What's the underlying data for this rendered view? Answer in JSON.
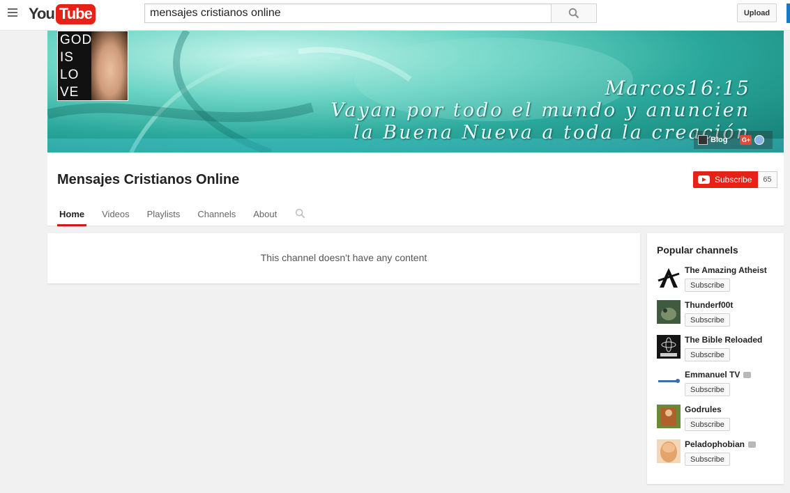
{
  "masthead": {
    "logo_you": "You",
    "logo_tube": "Tube",
    "search_value": "mensajes cristianos online",
    "upload_label": "Upload"
  },
  "banner": {
    "reference": "Marcos16:15",
    "line1": "Vayan por todo el mundo y anuncien",
    "line2": "la Buena Nueva  a  toda la  creación",
    "blog_label": "Blog",
    "gplus_label": "G+"
  },
  "avatar": {
    "text_lines": [
      "GOD",
      "IS",
      "LO",
      "VE"
    ]
  },
  "channel": {
    "title": "Mensajes Cristianos Online",
    "subscribe_label": "Subscribe",
    "subscriber_count": "65"
  },
  "tabs": [
    {
      "label": "Home",
      "active": true
    },
    {
      "label": "Videos",
      "active": false
    },
    {
      "label": "Playlists",
      "active": false
    },
    {
      "label": "Channels",
      "active": false
    },
    {
      "label": "About",
      "active": false
    }
  ],
  "content": {
    "empty_message": "This channel doesn't have any content"
  },
  "sidebar": {
    "title": "Popular channels",
    "subscribe_label": "Subscribe",
    "channels": [
      {
        "name": "The Amazing Atheist",
        "verified": false,
        "thumb_color": "#1a1a1a"
      },
      {
        "name": "Thunderf00t",
        "verified": false,
        "thumb_color": "#4a6a4a"
      },
      {
        "name": "The Bible Reloaded",
        "verified": false,
        "thumb_color": "#151515"
      },
      {
        "name": "Emmanuel TV",
        "verified": true,
        "thumb_color": "#e8eef5"
      },
      {
        "name": "Godrules",
        "verified": false,
        "thumb_color": "#7a5a2a"
      },
      {
        "name": "Peladophobian",
        "verified": true,
        "thumb_color": "#e3b27c"
      }
    ]
  },
  "colors": {
    "brand_red": "#e62117",
    "tab_active": "#cc181e"
  }
}
